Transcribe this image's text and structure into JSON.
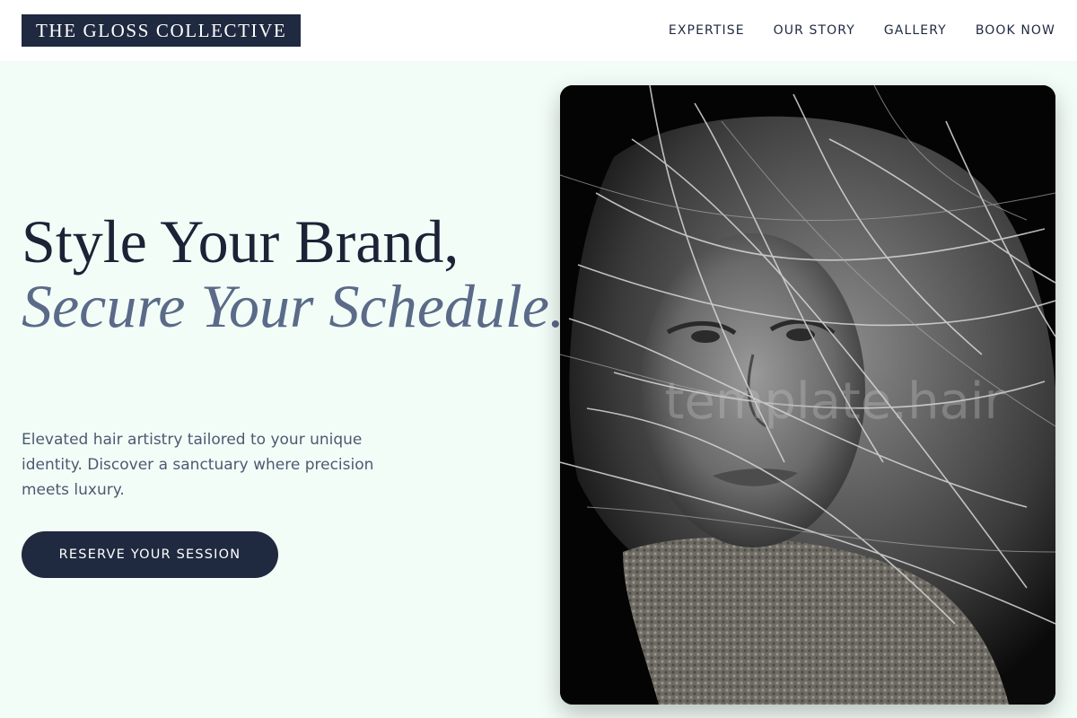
{
  "header": {
    "logo": "THE GLOSS COLLECTIVE",
    "nav": [
      "EXPERTISE",
      "OUR STORY",
      "GALLERY",
      "BOOK NOW"
    ]
  },
  "hero": {
    "title_line1": "Style Your Brand,",
    "title_accent": "Secure Your Schedule.",
    "description": "Elevated hair artistry tailored to your unique identity. Discover a sanctuary where precision meets luxury.",
    "cta_label": "RESERVE YOUR SESSION"
  },
  "photo": {
    "watermark": "template.hair",
    "subject": "portrait-photo"
  },
  "colors": {
    "navy": "#1f2a40",
    "accent_slate": "#5a6a88",
    "background_mint": "#f3fdf8"
  }
}
